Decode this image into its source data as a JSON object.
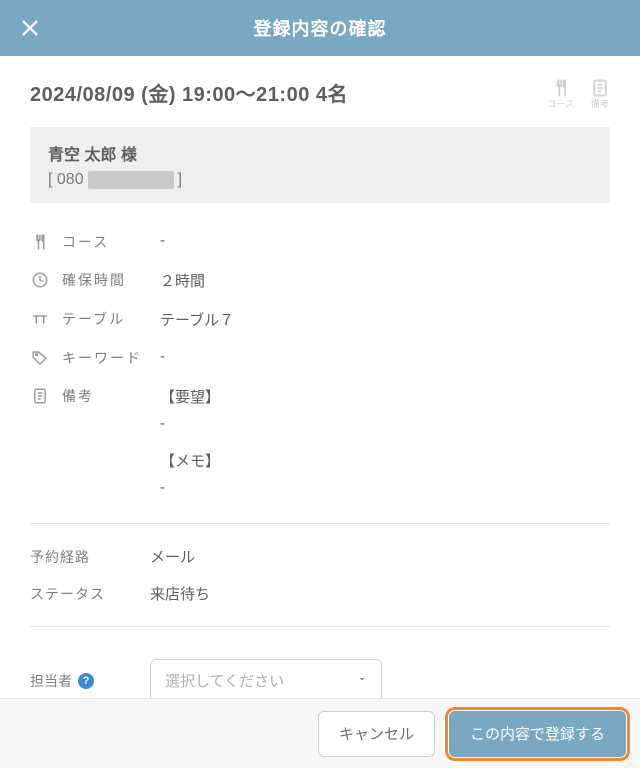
{
  "header": {
    "title": "登録内容の確認"
  },
  "summary": {
    "datetime": "2024/08/09 (金) 19:00～21:00 4名",
    "mini": {
      "course": "コース",
      "remarks": "備考"
    }
  },
  "customer": {
    "name": "青空 太郎 様",
    "phone_prefix": "[ 080",
    "phone_suffix": " ]"
  },
  "details": {
    "course": {
      "label": "コース",
      "value": "-"
    },
    "hold": {
      "label": "確保時間",
      "value": "２時間"
    },
    "table": {
      "label": "テーブル",
      "value": "テーブル７"
    },
    "keyword": {
      "label": "キーワード",
      "value": "-"
    },
    "remarks": {
      "label": "備考",
      "request_heading": "【要望】",
      "request_value": "-",
      "memo_heading": "【メモ】",
      "memo_value": "-"
    }
  },
  "meta": {
    "route": {
      "label": "予約経路",
      "value": "メール"
    },
    "status": {
      "label": "ステータス",
      "value": "来店待ち"
    }
  },
  "assignee": {
    "label": "担当者",
    "placeholder": "選択してください"
  },
  "footer": {
    "cancel": "キャンセル",
    "submit": "この内容で登録する"
  }
}
